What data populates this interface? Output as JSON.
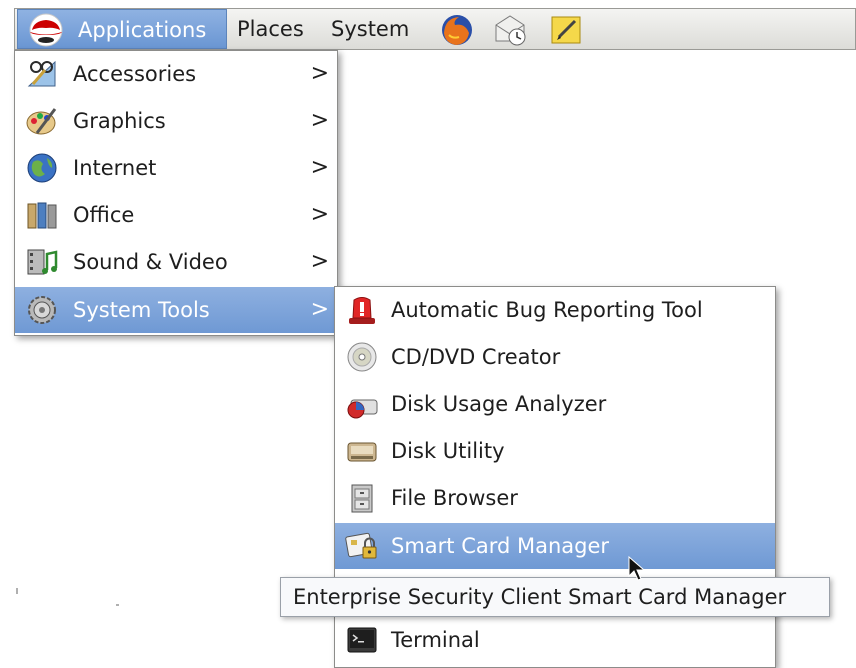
{
  "panel": {
    "applications": "Applications",
    "places": "Places",
    "system": "System",
    "launchers": [
      "firefox-icon",
      "mail-clock-icon",
      "notes-icon"
    ]
  },
  "main_menu": {
    "items": [
      {
        "label": "Accessories",
        "icon": "accessories-icon"
      },
      {
        "label": "Graphics",
        "icon": "graphics-icon"
      },
      {
        "label": "Internet",
        "icon": "internet-icon"
      },
      {
        "label": "Office",
        "icon": "office-icon"
      },
      {
        "label": "Sound & Video",
        "icon": "sound-video-icon"
      },
      {
        "label": "System Tools",
        "icon": "system-tools-icon",
        "highlighted": true
      }
    ],
    "submenu_arrow": ">"
  },
  "system_tools_menu": {
    "items": [
      {
        "label": "Automatic Bug Reporting Tool",
        "icon": "bug-report-icon"
      },
      {
        "label": "CD/DVD Creator",
        "icon": "cd-icon"
      },
      {
        "label": "Disk Usage Analyzer",
        "icon": "disk-usage-icon"
      },
      {
        "label": "Disk Utility",
        "icon": "disk-utility-icon"
      },
      {
        "label": "File Browser",
        "icon": "file-browser-icon"
      },
      {
        "label": "Smart Card Manager",
        "icon": "smart-card-icon",
        "highlighted": true
      },
      {
        "label": "Terminal",
        "icon": "terminal-icon"
      }
    ]
  },
  "tooltip": {
    "text": "Enterprise Security Client Smart Card Manager"
  },
  "colors": {
    "highlight": "#7aa2d9",
    "menu_background": "#ffffff"
  }
}
